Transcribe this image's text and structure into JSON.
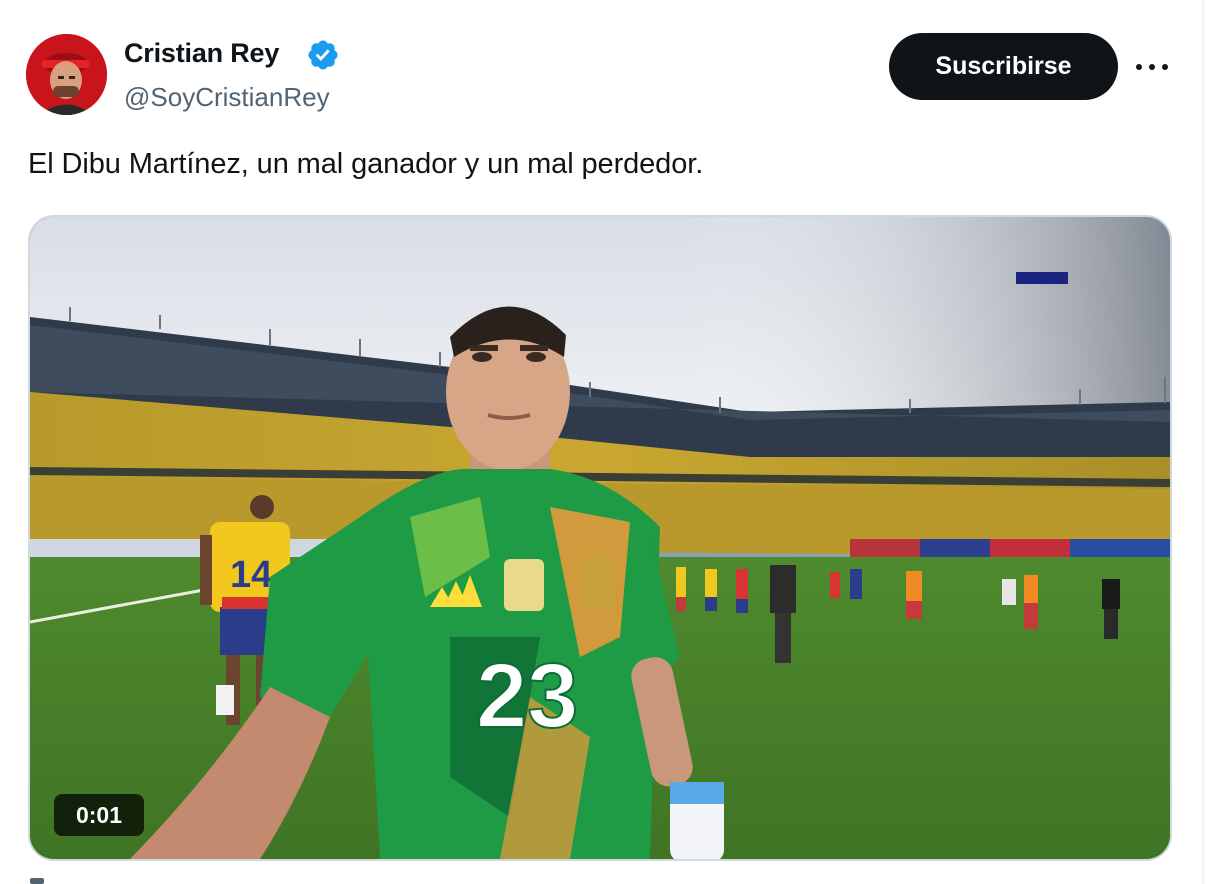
{
  "author": {
    "display_name": "Cristian Rey",
    "handle": "@SoyCristianRey",
    "verified": true,
    "verified_icon": "verified-badge-icon",
    "avatar_color": "#c8141b"
  },
  "actions": {
    "subscribe_label": "Suscribirse",
    "more_icon": "more-horizontal-icon"
  },
  "tweet": {
    "text": "El Dibu Martínez, un mal ganador y un mal perdedor."
  },
  "media": {
    "type": "video",
    "timestamp": "0:01",
    "player_number": "23"
  },
  "colors": {
    "text_primary": "#0f1419",
    "text_secondary": "#536471",
    "verified_blue": "#1d9bf0",
    "button_bg": "#0f1419",
    "border": "#cfd9de"
  }
}
